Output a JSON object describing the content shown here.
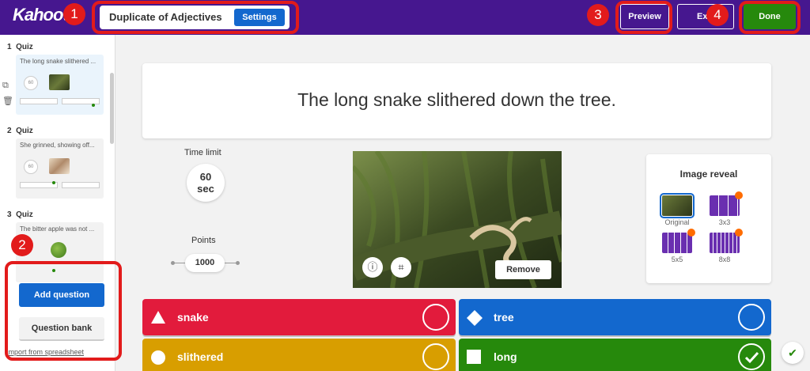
{
  "header": {
    "logo": "Kahoot!",
    "kahoot_title": "Duplicate of Adjectives",
    "settings_label": "Settings",
    "preview_label": "Preview",
    "exit_label": "Exit",
    "done_label": "Done"
  },
  "annotations": [
    "1",
    "2",
    "3",
    "4"
  ],
  "sidebar": {
    "questions": [
      {
        "number": "1",
        "type": "Quiz",
        "text": "The long snake slithered ...",
        "time": "60"
      },
      {
        "number": "2",
        "type": "Quiz",
        "text": "She grinned, showing off...",
        "time": "60"
      },
      {
        "number": "3",
        "type": "Quiz",
        "text": "The bitter apple was not ...",
        "time": "60"
      }
    ],
    "add_question_label": "Add question",
    "question_bank_label": "Question bank",
    "import_label": "Import from spreadsheet"
  },
  "editor": {
    "question_text": "The long snake slithered down the tree.",
    "time_limit_label": "Time limit",
    "time_limit_value": "60",
    "time_limit_unit": "sec",
    "points_label": "Points",
    "points_value": "1000",
    "remove_label": "Remove",
    "image_reveal": {
      "title": "Image reveal",
      "options": [
        "Original",
        "3x3",
        "5x5",
        "8x8"
      ],
      "selected": "Original"
    }
  },
  "answers": [
    {
      "text": "snake",
      "color": "#e21b3c",
      "shape": "triangle",
      "correct": false
    },
    {
      "text": "tree",
      "color": "#1368ce",
      "shape": "diamond",
      "correct": false
    },
    {
      "text": "slithered",
      "color": "#d89e00",
      "shape": "circle",
      "correct": false
    },
    {
      "text": "long",
      "color": "#26890c",
      "shape": "square",
      "correct": true
    }
  ]
}
